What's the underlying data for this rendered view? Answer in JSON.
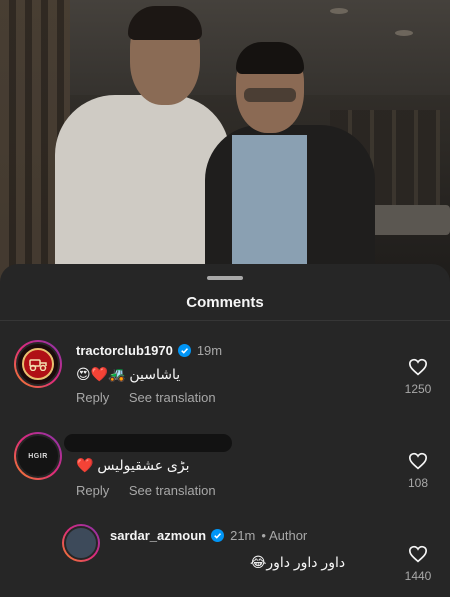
{
  "sheet": {
    "title": "Comments"
  },
  "comments": [
    {
      "username": "tractorclub1970",
      "verified": true,
      "time": "19m",
      "text": "یاشاسین 🚜❤️😍",
      "actions": {
        "reply": "Reply",
        "translate": "See translation"
      },
      "likes": "1250",
      "avatar_icon": "tractor-club-logo"
    },
    {
      "username": "",
      "text": "بڑی عشقیولیس ❤️",
      "actions": {
        "reply": "Reply",
        "translate": "See translation"
      },
      "likes": "108",
      "avatar_text": "HGIR"
    },
    {
      "username": "sardar_azmoun",
      "verified": true,
      "time": "21m",
      "author_tag": "Author",
      "text": "داور داور داور😂",
      "likes": "1440"
    }
  ],
  "colors": {
    "sheet_bg": "#262626",
    "verified_blue": "#0095f6",
    "muted": "#a8a8a8"
  }
}
